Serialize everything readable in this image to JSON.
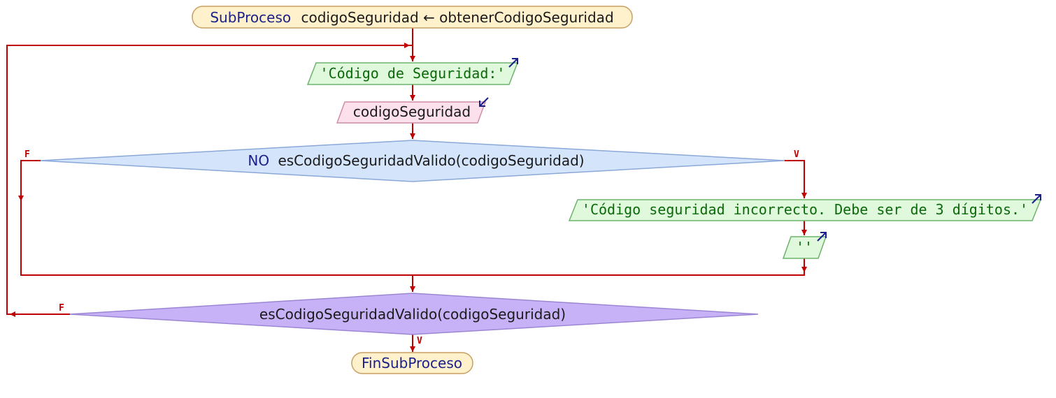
{
  "header": {
    "keyword": "SubProceso",
    "signature": "codigoSeguridad ← obtenerCodigoSeguridad"
  },
  "output_prompt": "'Código de Seguridad:'",
  "input_var": "codigoSeguridad",
  "decision": {
    "negation": "NO",
    "condition": "esCodigoSeguridadValido(codigoSeguridad)",
    "false_label": "F",
    "true_label": "V"
  },
  "error_output": "'Código seguridad incorrecto. Debe ser de 3 dígitos.'",
  "blank_output": "''",
  "loop_condition": {
    "condition": "esCodigoSeguridadValido(codigoSeguridad)",
    "false_label": "F",
    "true_label": "V"
  },
  "footer": {
    "keyword": "FinSubProceso"
  },
  "colors": {
    "flow_line": "#c00000",
    "terminal_fill": "#fff1cc",
    "terminal_stroke": "#c8a060",
    "output_fill": "#e0f8dc",
    "output_stroke": "#6cb36c",
    "input_fill": "#fce0ec",
    "input_stroke": "#d08ca8",
    "decision_fill": "#d4e4fb",
    "decision_stroke": "#8aa8d8",
    "loop_fill": "#c7b2f7",
    "loop_stroke": "#9b86d4",
    "keyword_text": "#1b1f8a",
    "string_text": "#0a6a0a"
  }
}
